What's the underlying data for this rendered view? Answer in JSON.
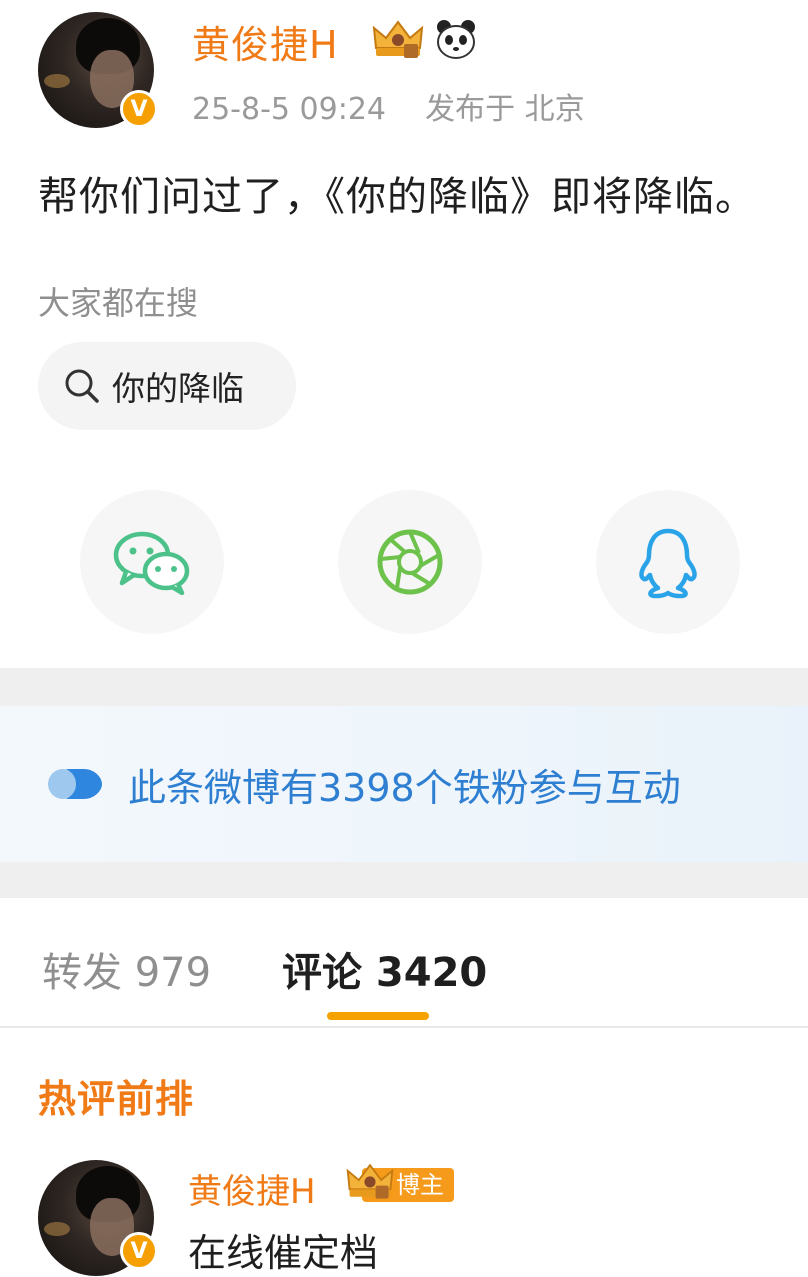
{
  "post": {
    "author": "黄俊捷H",
    "badges": [
      "crown-icon",
      "panda-icon"
    ],
    "verified_mark": "V",
    "time": "25-8-5 09:24",
    "location": "发布于 北京",
    "text": "帮你们问过了，《你的降临》即将降临。"
  },
  "search": {
    "hint": "大家都在搜",
    "chip": "你的降临"
  },
  "share": {
    "items": [
      {
        "icon": "wechat-icon",
        "color": "#4cc28a"
      },
      {
        "icon": "moments-icon",
        "color": "#6cc24a"
      },
      {
        "icon": "qq-icon",
        "color": "#2aa3e8"
      }
    ]
  },
  "banner": {
    "text": "此条微博有3398个铁粉参与互动",
    "color": "#2e7fd1"
  },
  "tabs": {
    "repost": "转发 979",
    "comment": "评论 3420"
  },
  "comments": {
    "section_title": "热评前排",
    "first": {
      "author": "黄俊捷H",
      "tag": "博主",
      "verified_mark": "V",
      "text": "在线催定档"
    }
  },
  "colors": {
    "accent": "#f07a16",
    "tab_underline": "#f5a100",
    "link_blue": "#2e7fd1"
  }
}
